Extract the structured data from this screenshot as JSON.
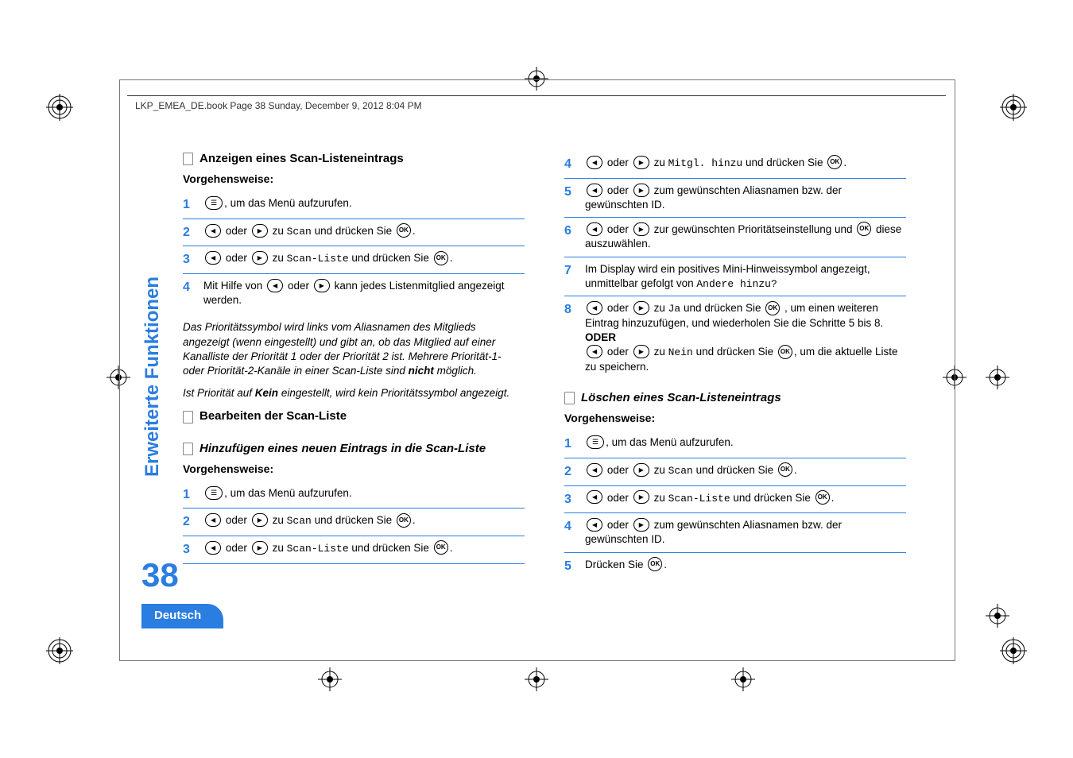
{
  "header": "LKP_EMEA_DE.book  Page 38  Sunday, December 9, 2012  8:04 PM",
  "sidebar": "Erweiterte Funktionen",
  "page_number": "38",
  "footer_lang": "Deutsch",
  "left": {
    "h1": "Anzeigen eines Scan-Listeneintrags",
    "proc": "Vorgehensweise:",
    "s1": ", um das Menü aufzurufen.",
    "s2a": " oder ",
    "s2b": " zu ",
    "s2c": "Scan",
    "s2d": " und drücken Sie ",
    "s2e": ".",
    "s3a": " oder ",
    "s3b": " zu ",
    "s3c": "Scan-Liste",
    "s3d": " und drücken Sie ",
    "s3e": ".",
    "s4a": "Mit Hilfe von ",
    "s4b": " oder ",
    "s4c": " kann jedes Listenmitglied angezeigt werden.",
    "note1a": "Das Prioritätssymbol wird links vom Aliasnamen des Mitglieds angezeigt (wenn eingestellt) und gibt an, ob das Mitglied auf einer Kanalliste der Priorität 1 oder der Priorität 2 ist. Mehrere Priorität-1- oder Priorität-2-Kanäle in einer Scan-Liste sind ",
    "note1b": "nicht",
    "note1c": " möglich.",
    "note2a": "Ist Priorität auf ",
    "note2b": "Kein",
    "note2c": " eingestellt, wird kein Prioritätssymbol angezeigt.",
    "h2": "Bearbeiten der Scan-Liste",
    "h3": "Hinzufügen eines neuen Eintrags in die Scan-Liste",
    "proc2": "Vorgehensweise:",
    "b1": ", um das Menü aufzurufen.",
    "b2a": " oder ",
    "b2b": " zu ",
    "b2c": "Scan",
    "b2d": " und drücken Sie ",
    "b2e": ".",
    "b3a": " oder ",
    "b3b": " zu ",
    "b3c": "Scan-Liste",
    "b3d": " und drücken Sie ",
    "b3e": "."
  },
  "right": {
    "s4a": " oder ",
    "s4b": " zu ",
    "s4c": "Mitgl. hinzu",
    "s4d": " und drücken Sie ",
    "s4e": ".",
    "s5a": " oder ",
    "s5b": " zum gewünschten Aliasnamen bzw. der gewünschten ID.",
    "s6a": " oder ",
    "s6b": " zur gewünschten Prioritätseinstellung und ",
    "s6c": " diese auszuwählen.",
    "s7a": "Im Display wird ein positives Mini-Hinweissymbol angezeigt, unmittelbar gefolgt von ",
    "s7b": "Andere hinzu?",
    "s8a": " oder ",
    "s8b": " zu ",
    "s8c": "Ja",
    "s8d": " und drücken Sie ",
    "s8e": " , um einen weiteren Eintrag hinzuzufügen, und wiederholen Sie die Schritte 5 bis 8.",
    "or": "ODER",
    "s8f": " oder ",
    "s8g": " zu ",
    "s8h": "Nein",
    "s8i": " und drücken Sie ",
    "s8j": ", um die aktuelle Liste zu speichern.",
    "h4": "Löschen eines Scan-Listeneintrags",
    "proc": "Vorgehensweise:",
    "d1": ", um das Menü aufzurufen.",
    "d2a": " oder ",
    "d2b": " zu ",
    "d2c": "Scan",
    "d2d": " und drücken Sie ",
    "d2e": ".",
    "d3a": " oder ",
    "d3b": " zu ",
    "d3c": "Scan-Liste",
    "d3d": " und drücken Sie ",
    "d3e": ".",
    "d4a": " oder ",
    "d4b": " zum gewünschten Aliasnamen bzw. der gewünschten ID.",
    "d5a": "Drücken Sie ",
    "d5b": "."
  }
}
